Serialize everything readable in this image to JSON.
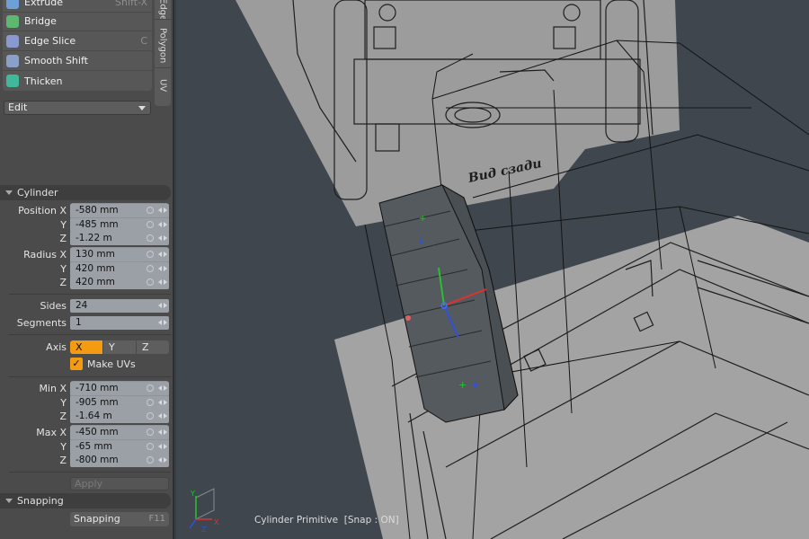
{
  "tools": [
    {
      "label": "Extrude",
      "shortcut": "Shift-X",
      "icon": "extrude-icon",
      "color": "#6ea0d8"
    },
    {
      "label": "Bridge",
      "shortcut": "",
      "icon": "bridge-icon",
      "color": "#5fb870"
    },
    {
      "label": "Edge Slice",
      "shortcut": "C",
      "icon": "edge-slice-icon",
      "color": "#8a9ad0"
    },
    {
      "label": "Smooth Shift",
      "shortcut": "",
      "icon": "smooth-shift-icon",
      "color": "#8aa0c8"
    },
    {
      "label": "Thicken",
      "shortcut": "",
      "icon": "thicken-icon",
      "color": "#42b89a"
    }
  ],
  "side_tabs": [
    "Edge",
    "Polygon",
    "UV"
  ],
  "edit_dropdown": "Edit",
  "cylinder": {
    "title": "Cylinder",
    "position": {
      "label": "Position X",
      "x": "-580 mm",
      "y": "-485 mm",
      "z": "-1.22 m"
    },
    "radius": {
      "label": "Radius X",
      "x": "130 mm",
      "y": "420 mm",
      "z": "420 mm"
    },
    "sides": {
      "label": "Sides",
      "value": "24"
    },
    "segments": {
      "label": "Segments",
      "value": "1"
    },
    "axis": {
      "label": "Axis",
      "options": [
        "X",
        "Y",
        "Z"
      ],
      "selected": "X"
    },
    "make_uvs": {
      "label": "Make UVs",
      "checked": true,
      "check_glyph": "✓"
    },
    "min": {
      "label": "Min X",
      "x": "-710 mm",
      "y": "-905 mm",
      "z": "-1.64 m"
    },
    "max": {
      "label": "Max X",
      "x": "-450 mm",
      "y": "-65 mm",
      "z": "-800 mm"
    },
    "y_label": "Y",
    "z_label": "Z",
    "apply": "Apply"
  },
  "snapping": {
    "title": "Snapping",
    "button": "Snapping",
    "shortcut": "F11"
  },
  "viewport": {
    "blueprint_text": "Вид сзади",
    "status": "Cylinder Primitive  [Snap : ON]",
    "axis_x": "X",
    "axis_y": "Y",
    "axis_z": "Z"
  },
  "colors": {
    "accent": "#f39c12",
    "panel": "#4b4b4b",
    "field": "#9aa0a6",
    "viewport_bg": "#3f464e"
  }
}
